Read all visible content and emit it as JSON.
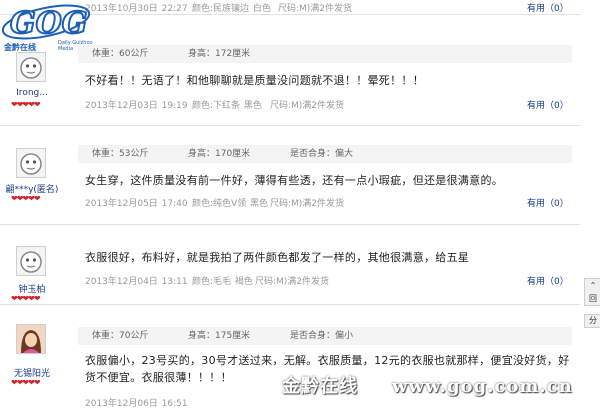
{
  "logo": {
    "title": "GOG",
    "subtitle": "金黔在线",
    "daily": "Daily Guizhou Media"
  },
  "reviews": [
    {
      "content": "",
      "time": "2013年10月30日 22:27",
      "color": "颜色:民族镶边 白色",
      "size": "尺码:M)满2件发货",
      "useful": "有用（0）"
    },
    {
      "user": "Irong...",
      "weight": "体重：60公斤",
      "height": "身高：172厘米",
      "fit": "",
      "content": "不好看！！无语了！和他聊聊就是质量没问题就不退！！晕死！！！",
      "time": "2013年12月03日 19:19",
      "color": "颜色:下红条 黑色",
      "size": "尺码:M)满2件发货",
      "useful": "有用（0）"
    },
    {
      "user": "翩***y(匿名)",
      "weight": "体重：53公斤",
      "height": "身高：170厘米",
      "fit": "是否合身：偏大",
      "content": "女生穿，这件质量没有前一件好，薄得有些透，还有一点小瑕疵，但还是很满意的。",
      "time": "2013年12月05日 17:40",
      "color": "颜色:纯色V领 黑色",
      "size": "尺码:M)满2件发货",
      "useful": "有用（0）"
    },
    {
      "user": "钟玉柏",
      "weight": "",
      "height": "",
      "fit": "",
      "content": "衣服很好，布料好，就是我拍了两件颜色都发了一样的，其他很满意，给五星",
      "time": "2013年12月04日 13:11",
      "color": "颜色:毛毛 褐色",
      "size": "尺码:M)满2件发货",
      "useful": "有用（0）"
    },
    {
      "user": "无锡阳光",
      "weight": "体重：70公斤",
      "height": "身高：175厘米",
      "fit": "是否合身：偏小",
      "content": "衣服偏小，23号买的，30号才送过来，无解。衣服质量，12元的衣服也就那样，便宜没好货，好货不便宜。衣服很薄！！！！",
      "time": "2013年12月06日 16:51",
      "color": "",
      "size": "",
      "useful": ""
    }
  ],
  "watermark": {
    "site": "金黔在线",
    "url": "www.gog.com.cn"
  },
  "side": {
    "top_label": "回",
    "share_label": "分"
  },
  "colors": {
    "link": "#1a3c8a",
    "heart": "#d1262e",
    "bar": "#f4f4f4"
  }
}
